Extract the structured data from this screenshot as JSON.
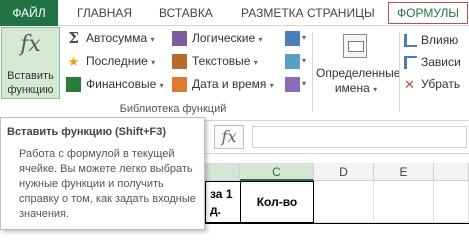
{
  "tabs": {
    "file": "ФАЙЛ",
    "home": "ГЛАВНАЯ",
    "insert": "ВСТАВКА",
    "page_layout": "РАЗМЕТКА СТРАНИЦЫ",
    "formulas": "ФОРМУЛЫ"
  },
  "ribbon": {
    "insert_function_line1": "Вставить",
    "insert_function_line2": "функцию",
    "fx_symbol": "fx",
    "autosum": "Автосумма",
    "recent": "Последние",
    "financial": "Финансовые",
    "logical": "Логические",
    "text": "Текстовые",
    "date_time": "Дата и время",
    "caret": "▾",
    "group_label": "Библиотека функций",
    "defined_names_line1": "Определенные",
    "defined_names_line2": "имена",
    "trace_precedents": "Влияю",
    "trace_dependents": "Зависи",
    "remove_arrows": "Убрать"
  },
  "formula_bar": {
    "fx_symbol": "fx"
  },
  "columns": {
    "c": "C",
    "d": "D",
    "e": "E"
  },
  "cells": {
    "b_header_line1": "за 1",
    "b_header_line2": "д.",
    "c_header": "Кол-во"
  },
  "tooltip": {
    "title": "Вставить функцию (Shift+F3)",
    "body": "Работа с формулой в текущей ячейке. Вы можете легко выбрать нужные функции и получить справку о том, как задать входные значения."
  },
  "colors": {
    "excel_green": "#217346",
    "active_tab_border": "#c0504d"
  },
  "icons": {
    "autosum": "sigma-icon",
    "recent": "star-icon",
    "financial": "financial-icon",
    "logical": "logical-icon",
    "text": "text-icon",
    "date_time": "calendar-icon"
  }
}
